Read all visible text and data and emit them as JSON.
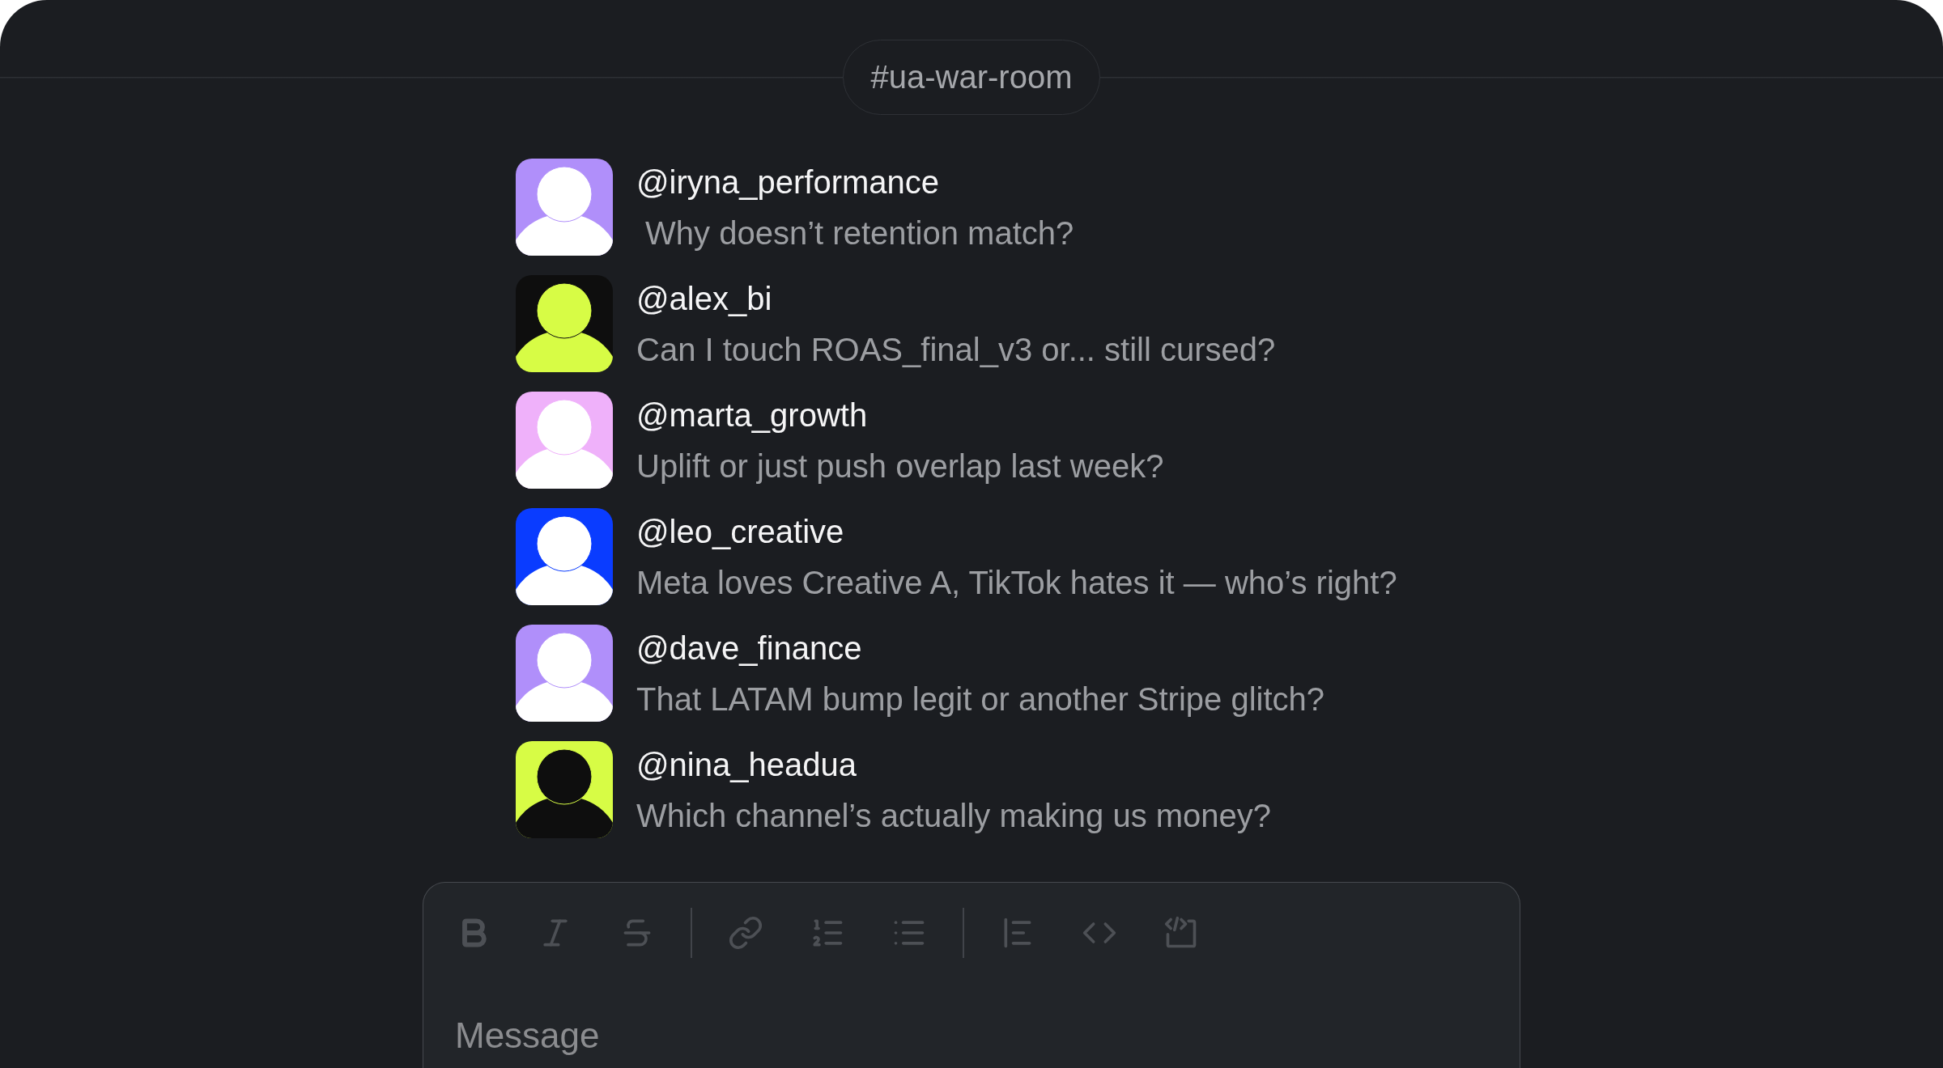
{
  "channel": {
    "name": "#ua-war-room"
  },
  "messages": [
    {
      "user": "@iryna_performance",
      "text": " Why doesn’t retention match?",
      "avatar": {
        "color": "#b08ffa",
        "figure": {
          "color": "#ffffff"
        }
      }
    },
    {
      "user": "@alex_bi",
      "text": "Can I touch ROAS_final_v3 or... still cursed?",
      "avatar": {
        "color": "#0e0e0e",
        "figure": {
          "color": "#d7fc45"
        }
      }
    },
    {
      "user": "@marta_growth",
      "text": "Uplift or just push overlap last week?",
      "avatar": {
        "color": "#efb1fa",
        "figure": {
          "color": "#ffffff"
        }
      }
    },
    {
      "user": "@leo_creative",
      "text": "Meta loves Creative A, TikTok hates it — who’s right?",
      "avatar": {
        "color": "#0a3cff",
        "figure": {
          "color": "#ffffff"
        }
      }
    },
    {
      "user": "@dave_finance",
      "text": "That LATAM bump legit or another Stripe glitch?",
      "avatar": {
        "color": "#b08ffa",
        "figure": {
          "color": "#ffffff"
        }
      }
    },
    {
      "user": "@nina_headua",
      "text": "Which channel’s actually making us money?",
      "avatar": {
        "color": "#d7fc45",
        "figure": {
          "color": "#0e0e0e"
        }
      }
    }
  ],
  "composer": {
    "toolbar_groups": [
      [
        {
          "kind": "bold",
          "disabled": true
        },
        {
          "kind": "italic",
          "disabled": true
        },
        {
          "kind": "strikethrough",
          "disabled": true
        }
      ],
      [
        {
          "kind": "link",
          "disabled": true
        },
        {
          "kind": "ordered_list",
          "disabled": true
        },
        {
          "kind": "bullet_list",
          "disabled": true
        }
      ],
      [
        {
          "kind": "blockquote",
          "disabled": true
        },
        {
          "kind": "code",
          "disabled": true
        },
        {
          "kind": "code_block",
          "disabled": true
        }
      ]
    ],
    "placeholder": "Message"
  }
}
